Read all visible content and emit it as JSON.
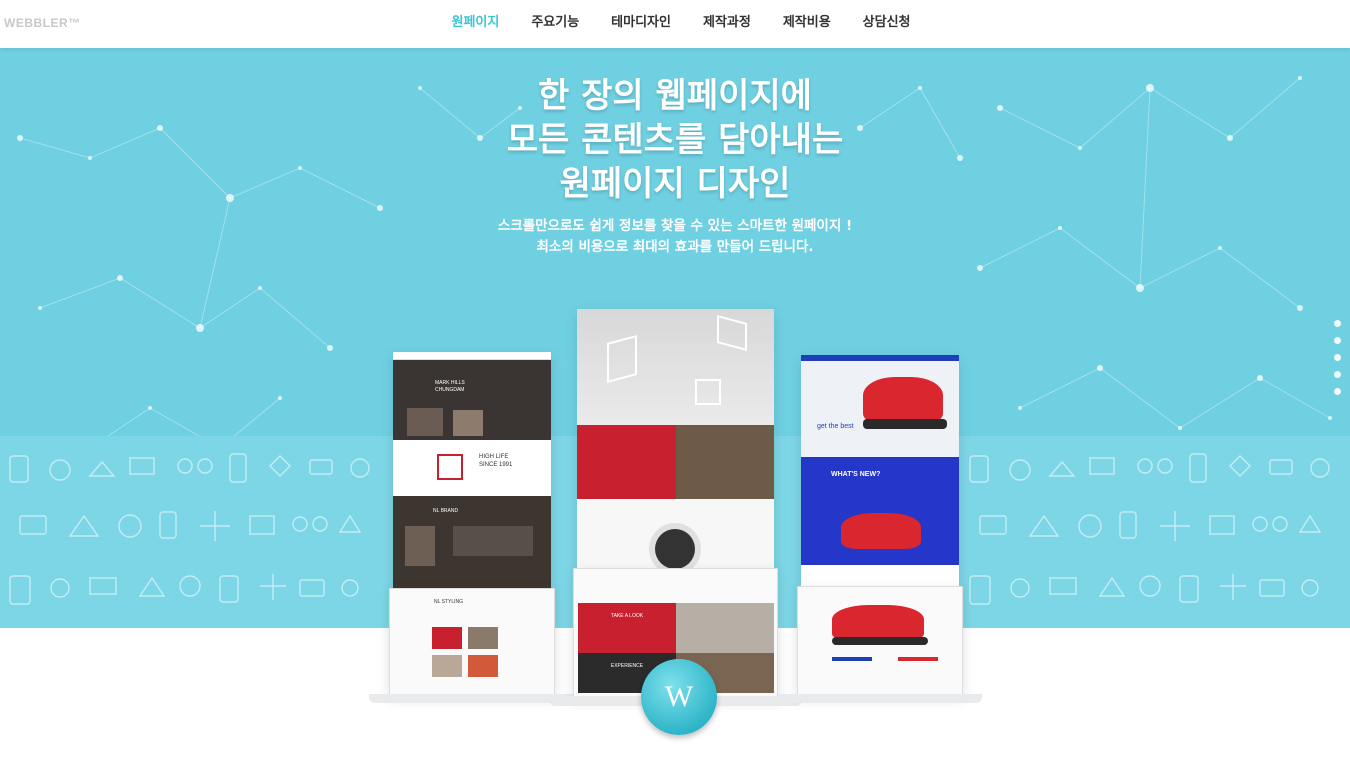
{
  "header": {
    "logo": "WEBBLER™",
    "nav": [
      {
        "label": "원페이지",
        "active": true
      },
      {
        "label": "주요기능",
        "active": false
      },
      {
        "label": "테마디자인",
        "active": false
      },
      {
        "label": "제작과정",
        "active": false
      },
      {
        "label": "제작비용",
        "active": false
      },
      {
        "label": "상담신청",
        "active": false
      }
    ]
  },
  "hero": {
    "headline": [
      "한 장의 웹페이지에",
      "모든 콘텐츠를 담아내는",
      "원페이지 디자인"
    ],
    "sub": [
      "스크롤만으로도 쉽게 정보를 찾을 수 있는 스마트한 원페이지 !",
      "최소의 비용으로 최대의 효과를 만들어 드립니다."
    ]
  },
  "devices": {
    "left": {
      "title1": "MARK HILLS",
      "title2": "CHUNGDAM",
      "life": "HIGH LIFE",
      "since": "SINCE 1991",
      "brand": "NL BRAND",
      "styling": "NL STYLING"
    },
    "center": {
      "take": "TAKE A LOOK",
      "experience": "EXPERIENCE"
    },
    "right": {
      "tag": "get the best",
      "whatsnew": "WHAT'S NEW?"
    }
  },
  "badge": "W",
  "colors": {
    "accent": "#3cc6d3",
    "hero": "#6fd0e2",
    "red": "#c8202f"
  }
}
